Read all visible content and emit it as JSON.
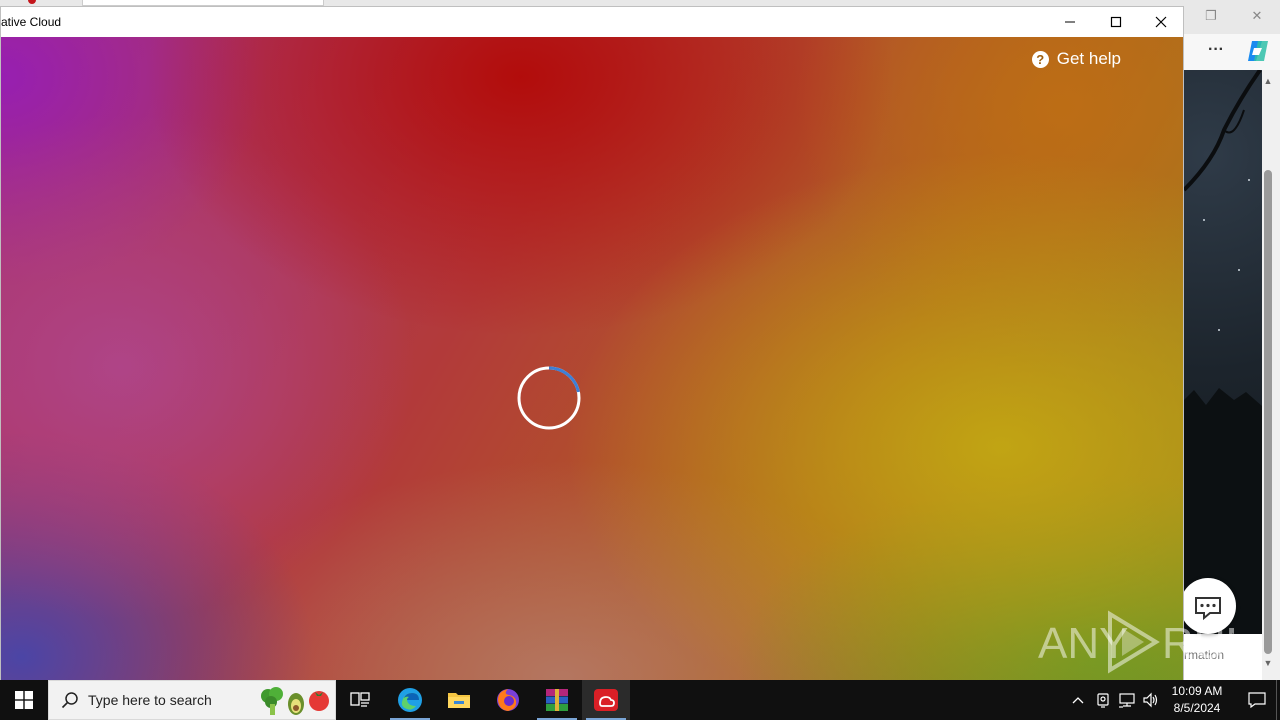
{
  "app_window": {
    "title": "ative Cloud",
    "help_label": "Get help",
    "loading": true
  },
  "background_browser": {
    "footer_text": "rmation"
  },
  "taskbar": {
    "search_placeholder": "Type here to search",
    "pinned": [
      {
        "name": "task-view",
        "label": "Task View"
      },
      {
        "name": "edge",
        "label": "Microsoft Edge"
      },
      {
        "name": "file-explorer",
        "label": "File Explorer"
      },
      {
        "name": "firefox",
        "label": "Firefox"
      },
      {
        "name": "winrar",
        "label": "WinRAR"
      },
      {
        "name": "creative-cloud",
        "label": "Adobe Creative Cloud",
        "active": true
      }
    ]
  },
  "clock": {
    "time": "10:09 AM",
    "date": "8/5/2024"
  },
  "watermark": {
    "left": "ANY",
    "right": "RUN"
  },
  "colors": {
    "taskbar_bg": "#101010",
    "accent_underline": "#7aa5d6",
    "spinner_track": "#ffffff",
    "spinner_arc": "#3d7fd6"
  }
}
